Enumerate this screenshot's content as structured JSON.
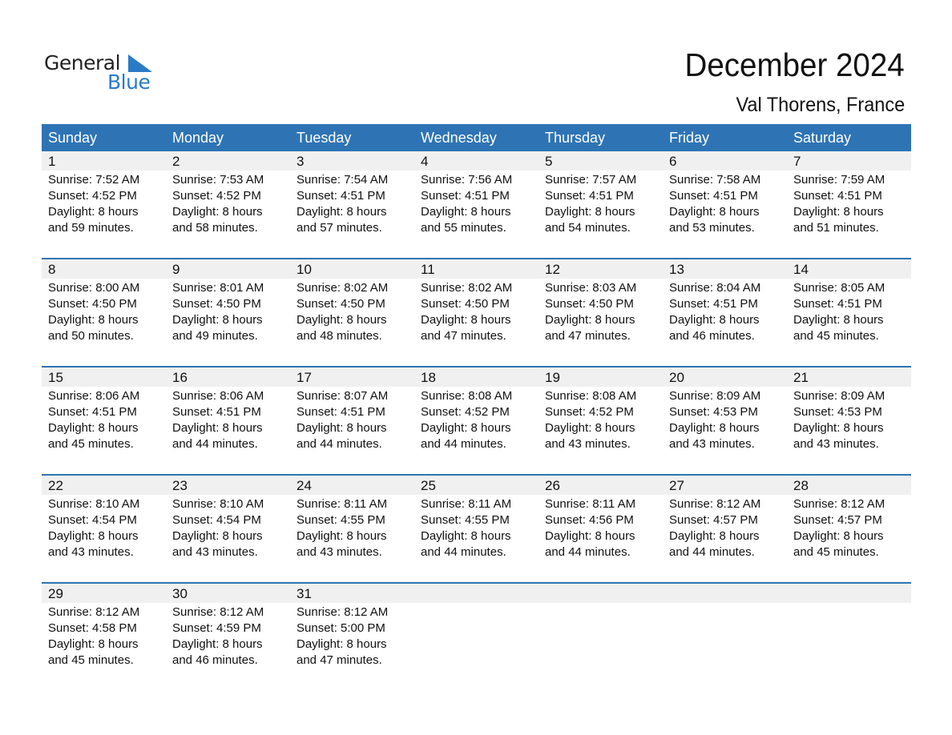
{
  "logo": {
    "line1": "General",
    "line2": "Blue",
    "accent_color": "#2a7bc6"
  },
  "header": {
    "title": "December 2024",
    "location": "Val Thorens, France"
  },
  "colors": {
    "header_bg": "#2e74b5",
    "day_row_bg": "#f0f0f0"
  },
  "weekdays": [
    "Sunday",
    "Monday",
    "Tuesday",
    "Wednesday",
    "Thursday",
    "Friday",
    "Saturday"
  ],
  "weeks": [
    [
      {
        "day": "1",
        "sunrise": "Sunrise: 7:52 AM",
        "sunset": "Sunset: 4:52 PM",
        "daylight1": "Daylight: 8 hours",
        "daylight2": "and 59 minutes."
      },
      {
        "day": "2",
        "sunrise": "Sunrise: 7:53 AM",
        "sunset": "Sunset: 4:52 PM",
        "daylight1": "Daylight: 8 hours",
        "daylight2": "and 58 minutes."
      },
      {
        "day": "3",
        "sunrise": "Sunrise: 7:54 AM",
        "sunset": "Sunset: 4:51 PM",
        "daylight1": "Daylight: 8 hours",
        "daylight2": "and 57 minutes."
      },
      {
        "day": "4",
        "sunrise": "Sunrise: 7:56 AM",
        "sunset": "Sunset: 4:51 PM",
        "daylight1": "Daylight: 8 hours",
        "daylight2": "and 55 minutes."
      },
      {
        "day": "5",
        "sunrise": "Sunrise: 7:57 AM",
        "sunset": "Sunset: 4:51 PM",
        "daylight1": "Daylight: 8 hours",
        "daylight2": "and 54 minutes."
      },
      {
        "day": "6",
        "sunrise": "Sunrise: 7:58 AM",
        "sunset": "Sunset: 4:51 PM",
        "daylight1": "Daylight: 8 hours",
        "daylight2": "and 53 minutes."
      },
      {
        "day": "7",
        "sunrise": "Sunrise: 7:59 AM",
        "sunset": "Sunset: 4:51 PM",
        "daylight1": "Daylight: 8 hours",
        "daylight2": "and 51 minutes."
      }
    ],
    [
      {
        "day": "8",
        "sunrise": "Sunrise: 8:00 AM",
        "sunset": "Sunset: 4:50 PM",
        "daylight1": "Daylight: 8 hours",
        "daylight2": "and 50 minutes."
      },
      {
        "day": "9",
        "sunrise": "Sunrise: 8:01 AM",
        "sunset": "Sunset: 4:50 PM",
        "daylight1": "Daylight: 8 hours",
        "daylight2": "and 49 minutes."
      },
      {
        "day": "10",
        "sunrise": "Sunrise: 8:02 AM",
        "sunset": "Sunset: 4:50 PM",
        "daylight1": "Daylight: 8 hours",
        "daylight2": "and 48 minutes."
      },
      {
        "day": "11",
        "sunrise": "Sunrise: 8:02 AM",
        "sunset": "Sunset: 4:50 PM",
        "daylight1": "Daylight: 8 hours",
        "daylight2": "and 47 minutes."
      },
      {
        "day": "12",
        "sunrise": "Sunrise: 8:03 AM",
        "sunset": "Sunset: 4:50 PM",
        "daylight1": "Daylight: 8 hours",
        "daylight2": "and 47 minutes."
      },
      {
        "day": "13",
        "sunrise": "Sunrise: 8:04 AM",
        "sunset": "Sunset: 4:51 PM",
        "daylight1": "Daylight: 8 hours",
        "daylight2": "and 46 minutes."
      },
      {
        "day": "14",
        "sunrise": "Sunrise: 8:05 AM",
        "sunset": "Sunset: 4:51 PM",
        "daylight1": "Daylight: 8 hours",
        "daylight2": "and 45 minutes."
      }
    ],
    [
      {
        "day": "15",
        "sunrise": "Sunrise: 8:06 AM",
        "sunset": "Sunset: 4:51 PM",
        "daylight1": "Daylight: 8 hours",
        "daylight2": "and 45 minutes."
      },
      {
        "day": "16",
        "sunrise": "Sunrise: 8:06 AM",
        "sunset": "Sunset: 4:51 PM",
        "daylight1": "Daylight: 8 hours",
        "daylight2": "and 44 minutes."
      },
      {
        "day": "17",
        "sunrise": "Sunrise: 8:07 AM",
        "sunset": "Sunset: 4:51 PM",
        "daylight1": "Daylight: 8 hours",
        "daylight2": "and 44 minutes."
      },
      {
        "day": "18",
        "sunrise": "Sunrise: 8:08 AM",
        "sunset": "Sunset: 4:52 PM",
        "daylight1": "Daylight: 8 hours",
        "daylight2": "and 44 minutes."
      },
      {
        "day": "19",
        "sunrise": "Sunrise: 8:08 AM",
        "sunset": "Sunset: 4:52 PM",
        "daylight1": "Daylight: 8 hours",
        "daylight2": "and 43 minutes."
      },
      {
        "day": "20",
        "sunrise": "Sunrise: 8:09 AM",
        "sunset": "Sunset: 4:53 PM",
        "daylight1": "Daylight: 8 hours",
        "daylight2": "and 43 minutes."
      },
      {
        "day": "21",
        "sunrise": "Sunrise: 8:09 AM",
        "sunset": "Sunset: 4:53 PM",
        "daylight1": "Daylight: 8 hours",
        "daylight2": "and 43 minutes."
      }
    ],
    [
      {
        "day": "22",
        "sunrise": "Sunrise: 8:10 AM",
        "sunset": "Sunset: 4:54 PM",
        "daylight1": "Daylight: 8 hours",
        "daylight2": "and 43 minutes."
      },
      {
        "day": "23",
        "sunrise": "Sunrise: 8:10 AM",
        "sunset": "Sunset: 4:54 PM",
        "daylight1": "Daylight: 8 hours",
        "daylight2": "and 43 minutes."
      },
      {
        "day": "24",
        "sunrise": "Sunrise: 8:11 AM",
        "sunset": "Sunset: 4:55 PM",
        "daylight1": "Daylight: 8 hours",
        "daylight2": "and 43 minutes."
      },
      {
        "day": "25",
        "sunrise": "Sunrise: 8:11 AM",
        "sunset": "Sunset: 4:55 PM",
        "daylight1": "Daylight: 8 hours",
        "daylight2": "and 44 minutes."
      },
      {
        "day": "26",
        "sunrise": "Sunrise: 8:11 AM",
        "sunset": "Sunset: 4:56 PM",
        "daylight1": "Daylight: 8 hours",
        "daylight2": "and 44 minutes."
      },
      {
        "day": "27",
        "sunrise": "Sunrise: 8:12 AM",
        "sunset": "Sunset: 4:57 PM",
        "daylight1": "Daylight: 8 hours",
        "daylight2": "and 44 minutes."
      },
      {
        "day": "28",
        "sunrise": "Sunrise: 8:12 AM",
        "sunset": "Sunset: 4:57 PM",
        "daylight1": "Daylight: 8 hours",
        "daylight2": "and 45 minutes."
      }
    ],
    [
      {
        "day": "29",
        "sunrise": "Sunrise: 8:12 AM",
        "sunset": "Sunset: 4:58 PM",
        "daylight1": "Daylight: 8 hours",
        "daylight2": "and 45 minutes."
      },
      {
        "day": "30",
        "sunrise": "Sunrise: 8:12 AM",
        "sunset": "Sunset: 4:59 PM",
        "daylight1": "Daylight: 8 hours",
        "daylight2": "and 46 minutes."
      },
      {
        "day": "31",
        "sunrise": "Sunrise: 8:12 AM",
        "sunset": "Sunset: 5:00 PM",
        "daylight1": "Daylight: 8 hours",
        "daylight2": "and 47 minutes."
      },
      {
        "day": "",
        "sunrise": "",
        "sunset": "",
        "daylight1": "",
        "daylight2": ""
      },
      {
        "day": "",
        "sunrise": "",
        "sunset": "",
        "daylight1": "",
        "daylight2": ""
      },
      {
        "day": "",
        "sunrise": "",
        "sunset": "",
        "daylight1": "",
        "daylight2": ""
      },
      {
        "day": "",
        "sunrise": "",
        "sunset": "",
        "daylight1": "",
        "daylight2": ""
      }
    ]
  ]
}
